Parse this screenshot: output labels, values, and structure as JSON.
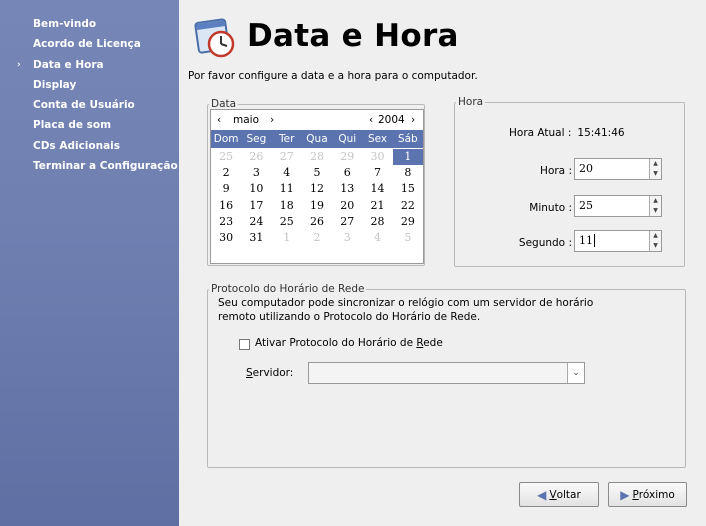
{
  "sidebar": {
    "items": [
      {
        "label": "Bem-vindo",
        "active": false
      },
      {
        "label": "Acordo de Licença",
        "active": false
      },
      {
        "label": "Data e Hora",
        "active": true
      },
      {
        "label": "Display",
        "active": false
      },
      {
        "label": "Conta de Usuário",
        "active": false
      },
      {
        "label": "Placa de som",
        "active": false
      },
      {
        "label": "CDs Adicionais",
        "active": false
      },
      {
        "label": "Terminar a Configuração",
        "active": false
      }
    ],
    "active_marker": "›"
  },
  "header": {
    "title": "Data e Hora",
    "subtitle": "Por favor configure a data e a hora para o computador.",
    "icon": "clock-calendar-icon"
  },
  "date_section": {
    "legend": "Data",
    "month": "maio",
    "year": "2004",
    "prev_month": "‹",
    "next_month": "›",
    "prev_year": "‹",
    "next_year": "›",
    "weekdays": [
      "Dom",
      "Seg",
      "Ter",
      "Qua",
      "Qui",
      "Sex",
      "Sáb"
    ],
    "weeks": [
      [
        {
          "d": "25",
          "m": true
        },
        {
          "d": "26",
          "m": true
        },
        {
          "d": "27",
          "m": true
        },
        {
          "d": "28",
          "m": true
        },
        {
          "d": "29",
          "m": true
        },
        {
          "d": "30",
          "m": true
        },
        {
          "d": "1",
          "s": true
        }
      ],
      [
        {
          "d": "2"
        },
        {
          "d": "3"
        },
        {
          "d": "4"
        },
        {
          "d": "5"
        },
        {
          "d": "6"
        },
        {
          "d": "7"
        },
        {
          "d": "8"
        }
      ],
      [
        {
          "d": "9"
        },
        {
          "d": "10"
        },
        {
          "d": "11"
        },
        {
          "d": "12"
        },
        {
          "d": "13"
        },
        {
          "d": "14"
        },
        {
          "d": "15"
        }
      ],
      [
        {
          "d": "16"
        },
        {
          "d": "17"
        },
        {
          "d": "18"
        },
        {
          "d": "19"
        },
        {
          "d": "20"
        },
        {
          "d": "21"
        },
        {
          "d": "22"
        }
      ],
      [
        {
          "d": "23"
        },
        {
          "d": "24"
        },
        {
          "d": "25"
        },
        {
          "d": "26"
        },
        {
          "d": "27"
        },
        {
          "d": "28"
        },
        {
          "d": "29"
        }
      ],
      [
        {
          "d": "30"
        },
        {
          "d": "31"
        },
        {
          "d": "1",
          "m": true
        },
        {
          "d": "2",
          "m": true
        },
        {
          "d": "3",
          "m": true
        },
        {
          "d": "4",
          "m": true
        },
        {
          "d": "5",
          "m": true
        }
      ]
    ]
  },
  "time_section": {
    "legend": "Hora",
    "current_label": "Hora Atual :",
    "current_value": "15:41:46",
    "hour_label": "Hora :",
    "hour_value": "20",
    "minute_label": "Minuto :",
    "minute_value": "25",
    "second_label": "Segundo :",
    "second_value": "11"
  },
  "ntp_section": {
    "legend": "Protocolo do Horário de Rede",
    "description": "Seu computador pode sincronizar o relógio com um servidor de horário remoto utilizando o Protocolo do Horário de Rede.",
    "checkbox_label_pre": "Ativar Protocolo do Horário de ",
    "checkbox_label_mnemonic": "R",
    "checkbox_label_post": "ede",
    "checkbox_checked": false,
    "server_label_mnemonic": "S",
    "server_label_rest": "ervidor:",
    "server_value": ""
  },
  "buttons": {
    "back_mnemonic": "V",
    "back_rest": "oltar",
    "next_mnemonic": "P",
    "next_rest": "róximo"
  },
  "colors": {
    "sidebar": "#6f7fb0",
    "selection": "#5b74b0"
  }
}
